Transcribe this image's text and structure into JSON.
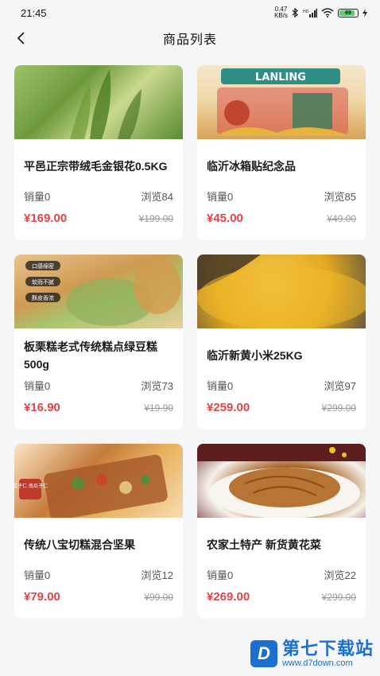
{
  "status": {
    "time": "21:45",
    "speed_top": "0.47",
    "speed_bottom": "KB/s",
    "battery": "69"
  },
  "header": {
    "title": "商品列表"
  },
  "products": [
    {
      "name": "平邑正宗带绒毛金银花0.5KG",
      "sales": "销量0",
      "views": "浏览84",
      "price": "¥169.00",
      "old_price": "¥199.00",
      "thumb_icon": "tea-leaves-image"
    },
    {
      "name": "临沂冰箱贴纪念品",
      "sales": "销量0",
      "views": "浏览85",
      "price": "¥45.00",
      "old_price": "¥49.00",
      "thumb_icon": "fridge-magnet-image"
    },
    {
      "name": "板栗糕老式传统糕点绿豆糕500g",
      "sales": "销量0",
      "views": "浏览73",
      "price": "¥16.90",
      "old_price": "¥19.90",
      "thumb_icon": "pastry-image"
    },
    {
      "name": "临沂新黄小米25KG",
      "sales": "销量0",
      "views": "浏览97",
      "price": "¥259.00",
      "old_price": "¥299.00",
      "thumb_icon": "millet-image"
    },
    {
      "name": "传统八宝切糕混合坚果",
      "sales": "销量0",
      "views": "浏览12",
      "price": "¥79.00",
      "old_price": "¥99.00",
      "thumb_icon": "nut-cake-image"
    },
    {
      "name": "农家土特产 新货黄花菜",
      "sales": "销量0",
      "views": "浏览22",
      "price": "¥269.00",
      "old_price": "¥299.00",
      "thumb_icon": "daylily-dish-image"
    }
  ],
  "thumb_labels": {
    "lanling": "LANLING",
    "tags": [
      "口感绵密",
      "软而不腻",
      "酥皮香浓"
    ],
    "nut_tag": "瓜子仁 南瓜子仁"
  },
  "watermark": {
    "cn": "第七下载站",
    "en": "www.d7down.com",
    "logo": "D"
  }
}
